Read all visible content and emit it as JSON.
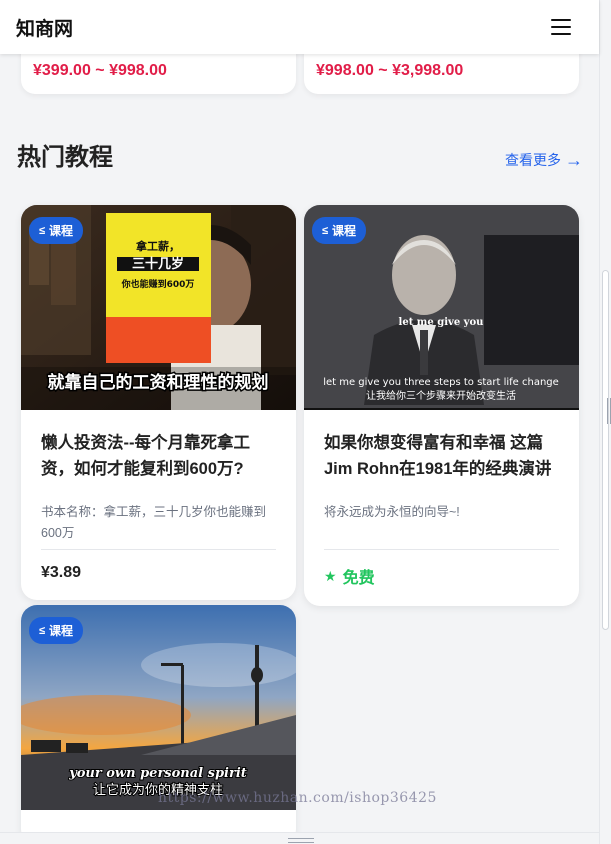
{
  "header": {
    "logo": "知商网"
  },
  "top_cards": [
    {
      "price": "¥399.00 ~ ¥998.00"
    },
    {
      "price": "¥998.00 ~ ¥3,998.00"
    }
  ],
  "section": {
    "title": "热门教程",
    "see_more": "查看更多",
    "see_more_arrow": "→"
  },
  "cards": [
    {
      "badge": "课程",
      "thumb_caption": "就靠自己的工资和理性的规划",
      "book_lines": [
        "拿工薪，",
        "三十几岁",
        "你也能赚到600万"
      ],
      "title": "懒人投资法--每个月靠死拿工资，如何才能复利到600万?",
      "desc": "书本名称：拿工薪，三十几岁你也能赚到600万",
      "price": "¥3.89"
    },
    {
      "badge": "课程",
      "thumb_caption_top": "let me give you",
      "thumb_caption_en": "let me give you three steps to start life change",
      "thumb_caption_cn": "让我给你三个步骤来开始改变生活",
      "title": "如果你想变得富有和幸福 这篇Jim Rohn在1981年的经典演讲",
      "desc": "将永远成为永恒的向导~!",
      "price": "免费"
    },
    {
      "badge": "课程",
      "thumb_caption_en": "your own personal spirit",
      "thumb_caption_cn": "让它成为你的精神支柱"
    }
  ],
  "watermark": "https://www.huzhan.com/ishop36425",
  "colors": {
    "accent": "#2563eb",
    "badge": "#1d5fd6",
    "price_red": "#e11d48",
    "free_green": "#22c55e"
  }
}
